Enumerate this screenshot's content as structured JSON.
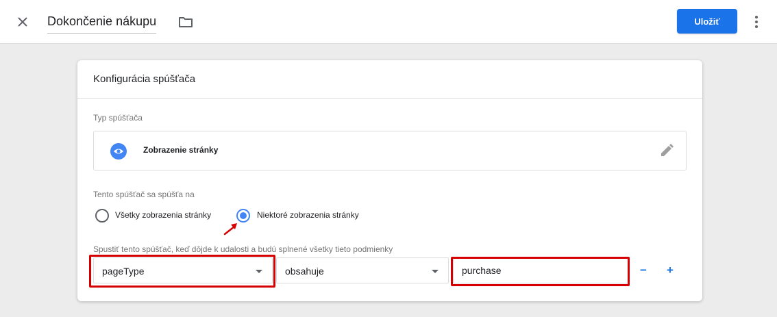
{
  "header": {
    "title": "Dokončenie nákupu",
    "save_label": "Uložiť"
  },
  "card": {
    "title": "Konfigurácia spúšťača",
    "trigger_type": {
      "label": "Typ spúšťača",
      "name": "Zobrazenie stránky",
      "icon": "eye-icon"
    },
    "fires_on": {
      "label": "Tento spúšťač sa spúšťa na",
      "options": [
        {
          "label": "Všetky zobrazenia stránky",
          "checked": false
        },
        {
          "label": "Niektoré zobrazenia stránky",
          "checked": true
        }
      ]
    },
    "condition": {
      "label": "Spustiť tento spúšťač, keď dôjde k udalosti a budú splnené všetky tieto podmienky",
      "variable": "pageType",
      "operator": "obsahuje",
      "value": "purchase",
      "remove_label": "−",
      "add_label": "+"
    }
  },
  "colors": {
    "accent": "#1a73e8",
    "highlight": "#d60000",
    "background": "#ececec"
  }
}
